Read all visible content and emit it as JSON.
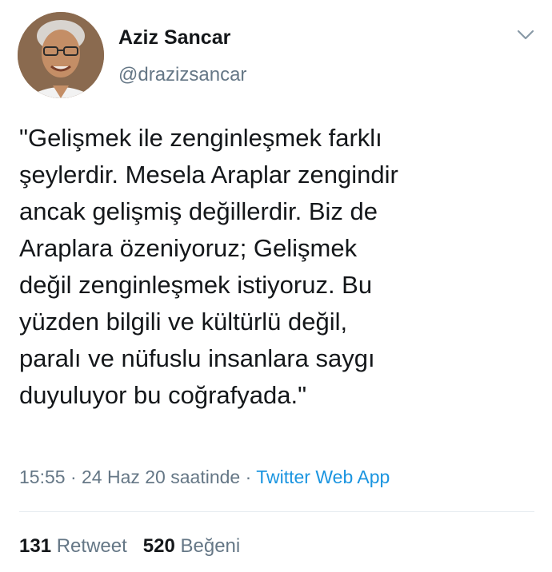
{
  "author": {
    "display_name": "Aziz Sancar",
    "username": "@drazizsancar"
  },
  "tweet": {
    "text": "\"Gelişmek ile zenginleşmek farklı\nşeylerdir. Mesela Araplar zengindir\nancak gelişmiş değillerdir. Biz de\nAraplara özeniyoruz; Gelişmek\ndeğil zenginleşmek istiyoruz. Bu\nyüzden bilgili ve kültürlü değil,\nparalı ve nüfuslu insanlara saygı\nduyuluyor bu coğrafyada.\"",
    "timestamp": "15:55 · 24 Haz 20 saatinde",
    "separator": " · ",
    "source": "Twitter Web App"
  },
  "stats": {
    "retweet_count": "131",
    "retweet_label": "Retweet",
    "like_count": "520",
    "like_label": "Beğeni"
  },
  "icons": {
    "menu": "chevron-down-icon"
  },
  "colors": {
    "text_primary": "#14171a",
    "text_secondary": "#657786",
    "link": "#1b95e0",
    "divider": "#e6ecf0"
  }
}
